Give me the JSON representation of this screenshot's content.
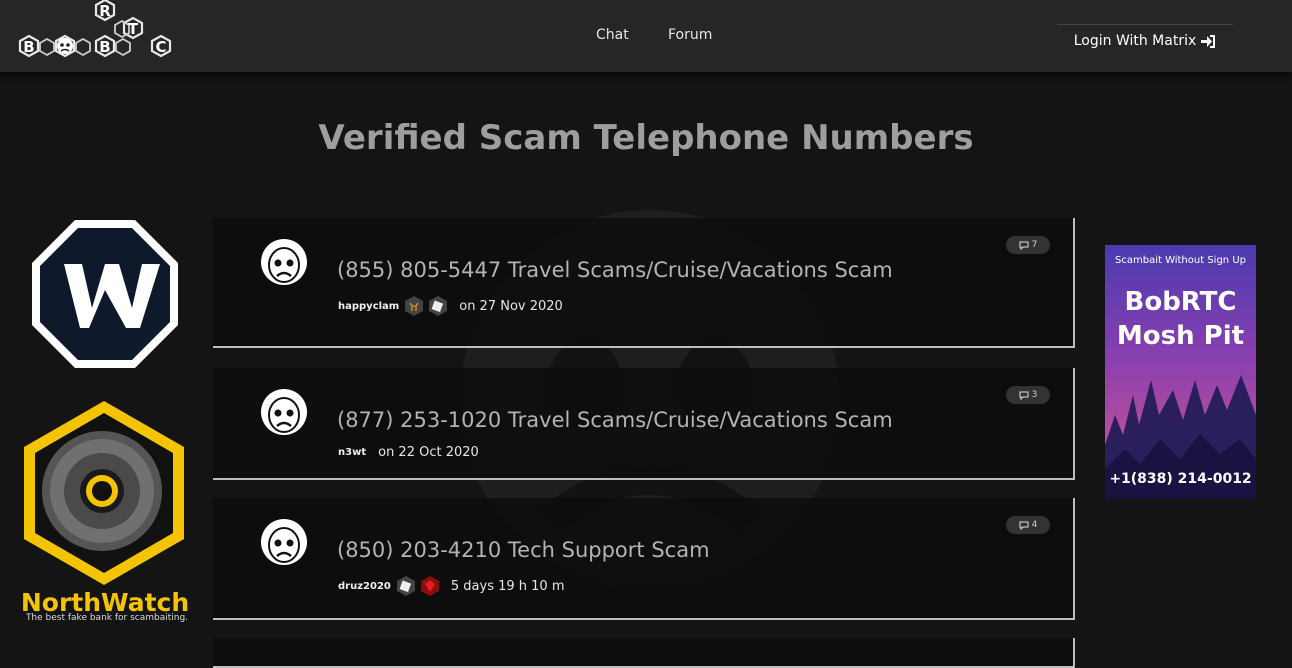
{
  "logo": {
    "letters": [
      "B",
      "B",
      "R",
      "B",
      "T",
      "C"
    ]
  },
  "nav": {
    "chat": "Chat",
    "forum": "Forum",
    "login": "Login With Matrix"
  },
  "page_title": "Verified Scam Telephone Numbers",
  "posts": [
    {
      "title": "(855) 805-5447 Travel Scams/Cruise/Vacations Scam",
      "user": "happyclam",
      "badges": [
        "deer-badge-icon",
        "dice-badge-icon"
      ],
      "date": "on 27 Nov 2020",
      "comments": "7"
    },
    {
      "title": "(877) 253-1020 Travel Scams/Cruise/Vacations Scam",
      "user": "n3wt",
      "badges": [],
      "date": "on 22 Oct 2020",
      "comments": "3"
    },
    {
      "title": "(850) 203-4210 Tech Support Scam",
      "user": "druz2020",
      "badges": [
        "dice-badge-icon",
        "ruby-badge-icon"
      ],
      "date": "5 days 19 h 10 m",
      "comments": "4"
    }
  ],
  "ads": {
    "northwatch_title": "NorthWatch",
    "northwatch_sub": "The best fake bank for scambaiting.",
    "moshpit_top": "Scambait Without Sign Up",
    "moshpit_line1": "BobRTC",
    "moshpit_line2": "Mosh Pit",
    "moshpit_phone": "+1(838) 214-0012"
  },
  "colors": {
    "accent": "#f5c400",
    "background": "#141414",
    "navbar": "#262626"
  }
}
